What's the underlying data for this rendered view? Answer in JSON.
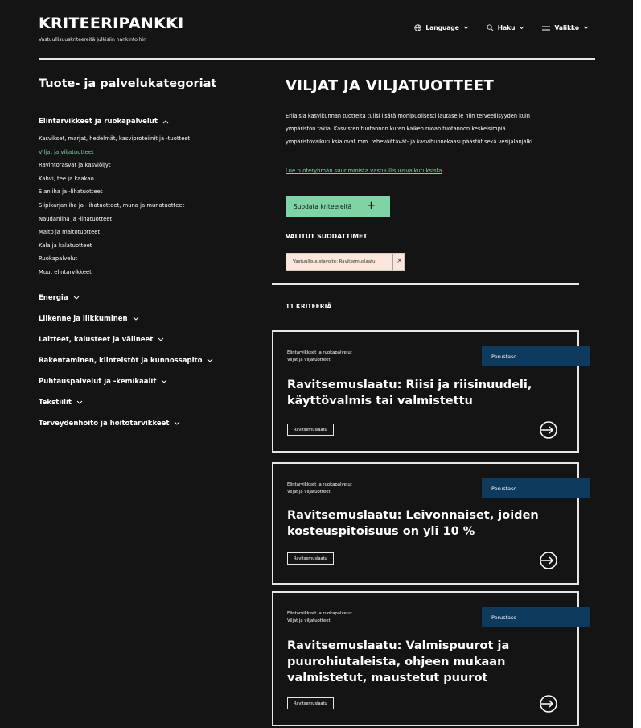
{
  "header": {
    "title": "KRITEERIPANKKI",
    "subtitle": "Vastuullisuuskriteereitä julkisiin hankintoihin",
    "nav": [
      {
        "label": "Language",
        "icon": "globe-icon"
      },
      {
        "label": "Haku",
        "icon": "search-icon"
      },
      {
        "label": "Valikko",
        "icon": "menu-icon"
      }
    ]
  },
  "sidebar": {
    "title": "Tuote- ja palvelukategoriat",
    "open_category": "Elintarvikkeet ja ruokapalvelut",
    "subcategories": [
      "Kasvikset, marjat, hedelmät, kasviproteiinit ja -tuotteet",
      "Viljat ja viljatuotteet",
      "Ravintorasvat ja kasviöljyt",
      "Kahvi, tee ja kaakao",
      "Sianliha ja -lihatuotteet",
      "Siipikarjanliha ja -lihatuotteet, muna ja munatuotteet",
      "Naudanliha ja -lihatuotteet",
      "Maito ja maitotuotteet",
      "Kala ja kalatuotteet",
      "Ruokapalvelut",
      "Muut elintarvikkeet"
    ],
    "active_subcategory": "Viljat ja viljatuotteet",
    "categories": [
      "Energia",
      "Liikenne ja liikkuminen",
      "Laitteet, kalusteet ja välineet",
      "Rakentaminen, kiinteistöt ja kunnossapito",
      "Puhtauspalvelut ja -kemikaalit",
      "Tekstiilit",
      "Terveydenhoito ja hoitotarvikkeet"
    ]
  },
  "main": {
    "title": "VILJAT JA VILJATUOTTEET",
    "intro": "Erilaisia kasvikunnan tuotteita tulisi lisätä monipuolisesti lautaselle niin terveellisyyden kuin ympäristön takia. Kasvisten tuotannon kuten kaiken ruoan tuotannon keskeisimpiä ympäristövaikutuksia ovat mm. rehevöittävät- ja kasvihuonekaasupäästöt sekä vesijalanjälki.",
    "link": "Lue tuoteryhmän suurimmista vastuullisuusvaikutuksista",
    "filter_button": "Suodata kriteereitä",
    "filter_plus": "+",
    "selected_filters_label": "VALITUT SUODATTIMET",
    "chip": "Vastuullisuustavoite: Ravitsemuslaatu",
    "chip_close": "×",
    "count": "11 KRITEERIÄ"
  },
  "cards": [
    {
      "category": "Elintarvikkeet ja ruokapalvelut",
      "subcategory": "Viljat ja viljatuotteet",
      "level": "Perustaso",
      "title": "Ravitsemuslaatu: Riisi ja riisinuudeli, käyttövalmis tai valmistettu",
      "tag": "Ravitsemuslaatu"
    },
    {
      "category": "Elintarvikkeet ja ruokapalvelut",
      "subcategory": "Viljat ja viljatuotteet",
      "level": "Perustaso",
      "title": "Ravitsemuslaatu: Leivonnaiset, joiden kosteuspitoisuus on yli 10 %",
      "tag": "Ravitsemuslaatu"
    },
    {
      "category": "Elintarvikkeet ja ruokapalvelut",
      "subcategory": "Viljat ja viljatuotteet",
      "level": "Perustaso",
      "title": "Ravitsemuslaatu: Valmispuurot ja puurohiutaleista, ohjeen mukaan valmistetut, maustetut puurot",
      "tag": "Ravitsemuslaatu"
    }
  ],
  "colors": {
    "background": "#141414",
    "accent": "#7fd4a6",
    "level_badge": "#0e3a5e",
    "chip": "#fbe6dc"
  }
}
